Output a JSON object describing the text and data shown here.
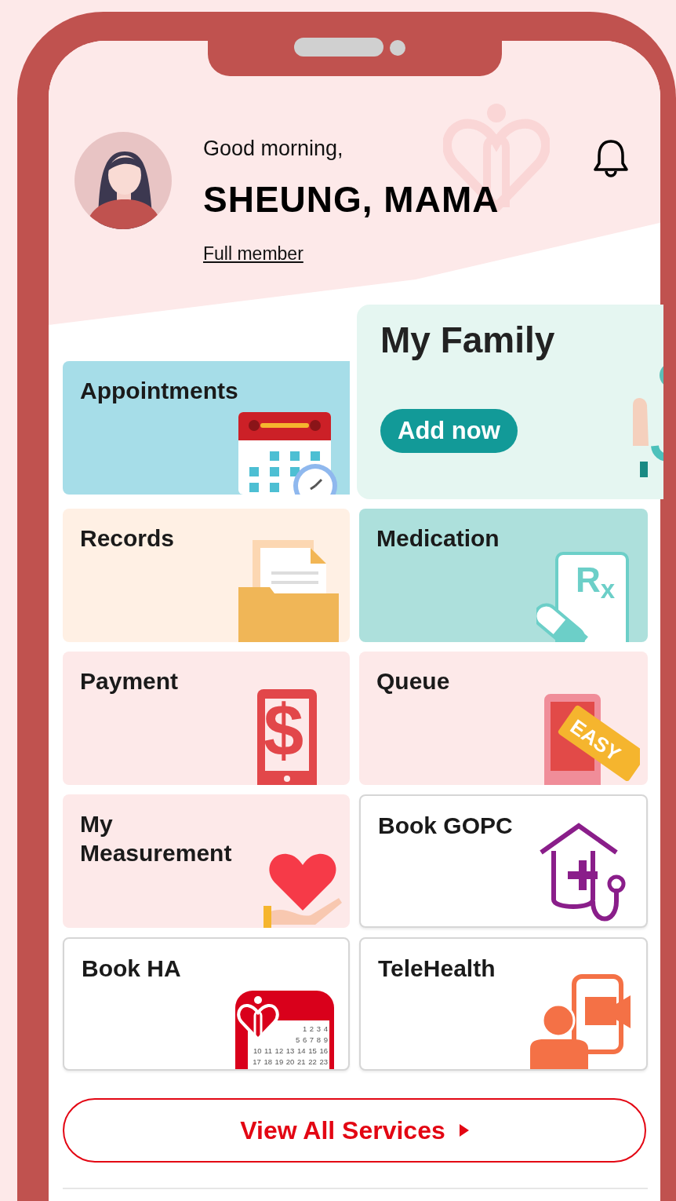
{
  "header": {
    "greeting": "Good morning,",
    "name": "SHEUNG, MAMA",
    "membership": "Full member"
  },
  "family_card": {
    "title": "My Family",
    "button": "Add now"
  },
  "tiles": [
    {
      "label": "Appointments",
      "kind": "appointments"
    },
    {
      "label": "Records",
      "kind": "records"
    },
    {
      "label": "Medication",
      "kind": "medication",
      "icon_text": "R$_{x}$"
    },
    {
      "label": "Payment",
      "kind": "payment",
      "icon_text": "$"
    },
    {
      "label": "Queue",
      "kind": "queue",
      "icon_text": "EASY"
    },
    {
      "label": "My Measurement",
      "kind": "measurement"
    },
    {
      "label": "Book GOPC",
      "kind": "gopc"
    },
    {
      "label": "Book HA",
      "kind": "bookha",
      "calendar_rows": [
        "1 2 3 4",
        "5 6 7 8 9",
        "10 11 12 13 14 15 16",
        "17 18 19 20 21 22 23"
      ]
    },
    {
      "label": "TeleHealth",
      "kind": "telehealth"
    }
  ],
  "view_all": {
    "label": "View All Services"
  }
}
